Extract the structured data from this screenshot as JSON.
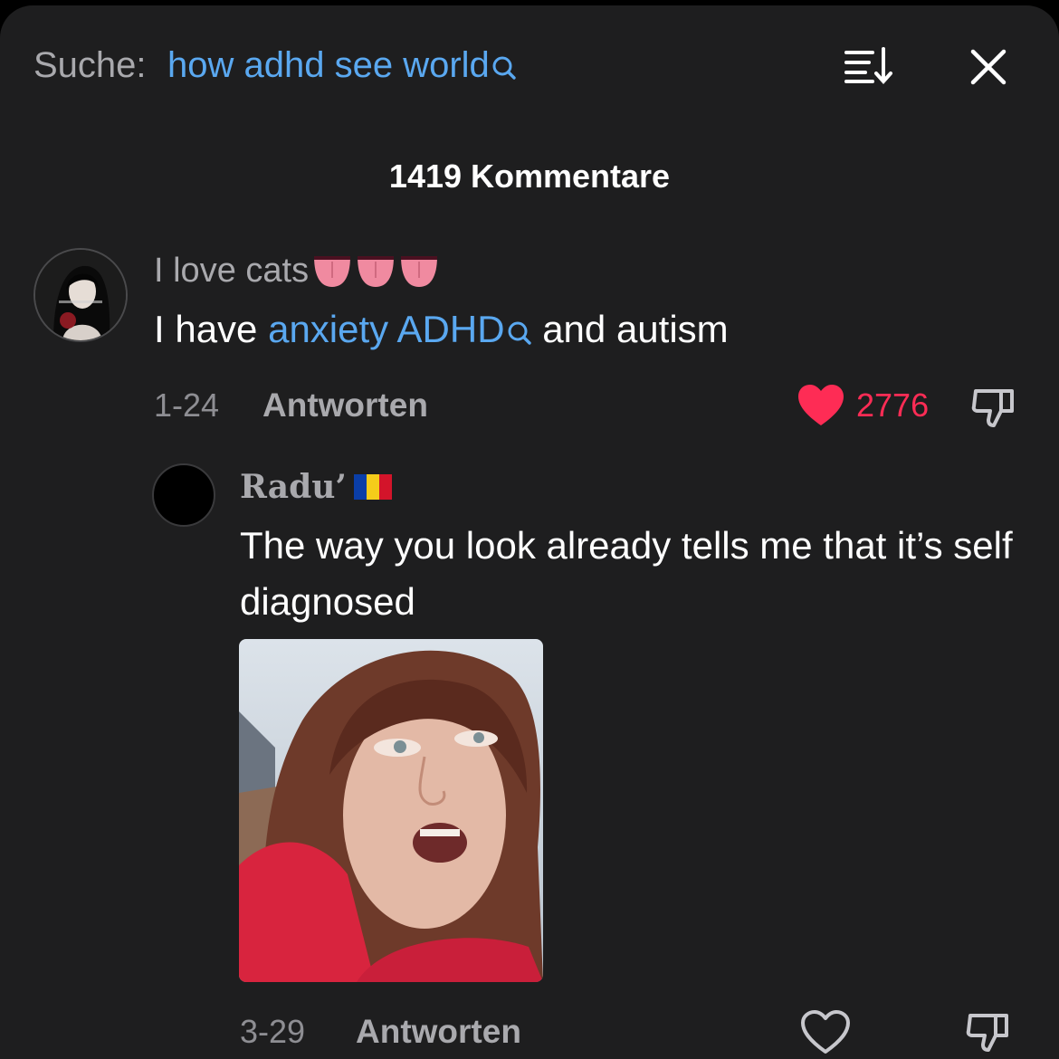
{
  "search": {
    "prefix": "Suche:",
    "query": "how adhd see world"
  },
  "header": {
    "comment_count": "1419 Kommentare"
  },
  "comments": [
    {
      "username": "I love cats",
      "emojis": [
        "tongue-emoji",
        "tongue-emoji",
        "tongue-emoji"
      ],
      "text_before": "I have ",
      "highlight": "anxiety ADHD",
      "text_after": " and autism",
      "date": "1-24",
      "reply_label": "Antworten",
      "likes": "2776",
      "liked": true
    },
    {
      "username": "Radu’",
      "flag": "romania-flag",
      "text": "The way you look already tells me that it’s self diagnosed",
      "date": "3-29",
      "reply_label": "Antworten",
      "liked": false
    }
  ],
  "colors": {
    "background": "#1e1e1f",
    "link": "#5aa8f0",
    "like": "#fe2c55",
    "muted": "#a9a9ad"
  }
}
